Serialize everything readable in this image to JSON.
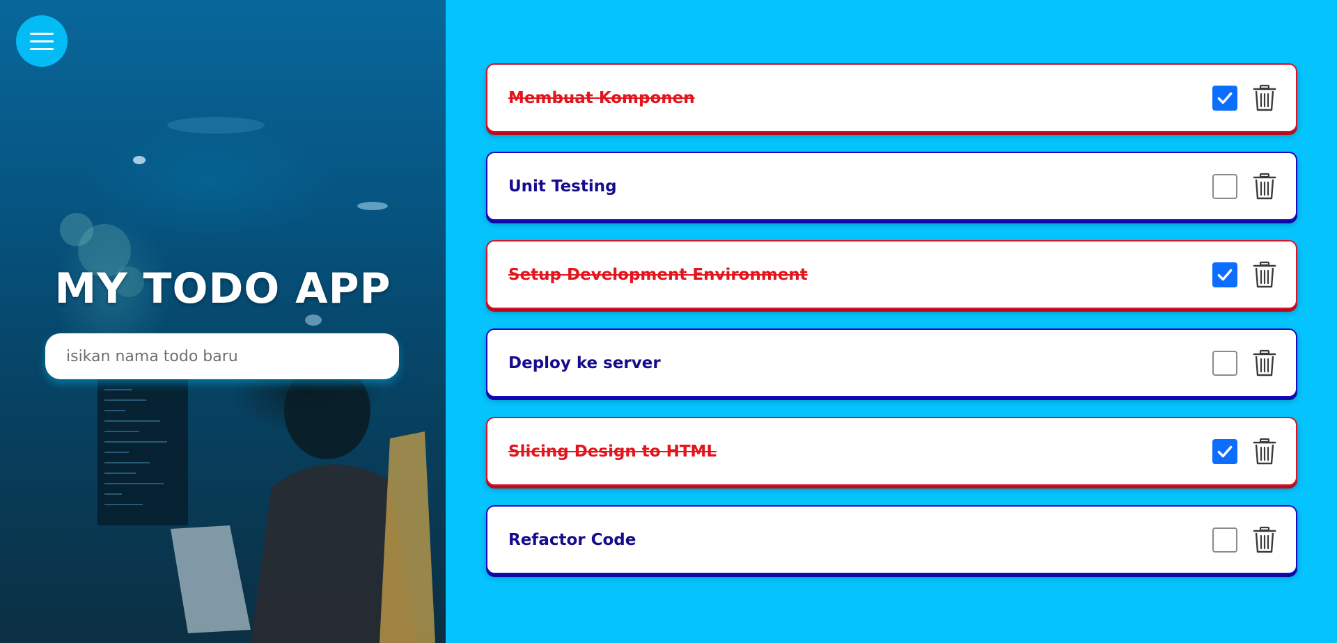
{
  "hero": {
    "title": "MY TODO APP",
    "input": {
      "placeholder": "isikan nama todo baru",
      "value": ""
    },
    "menu_icon": "hamburger-icon"
  },
  "colors": {
    "background": "#05c3fd",
    "done": "#e3141c",
    "pending": "#160b8c",
    "checkbox": "#0d6efd"
  },
  "todos": [
    {
      "text": "Membuat Komponen",
      "done": true
    },
    {
      "text": "Unit Testing",
      "done": false
    },
    {
      "text": "Setup Development Environment",
      "done": true
    },
    {
      "text": "Deploy ke server",
      "done": false
    },
    {
      "text": "Slicing Design to HTML",
      "done": true
    },
    {
      "text": "Refactor Code",
      "done": false
    }
  ]
}
